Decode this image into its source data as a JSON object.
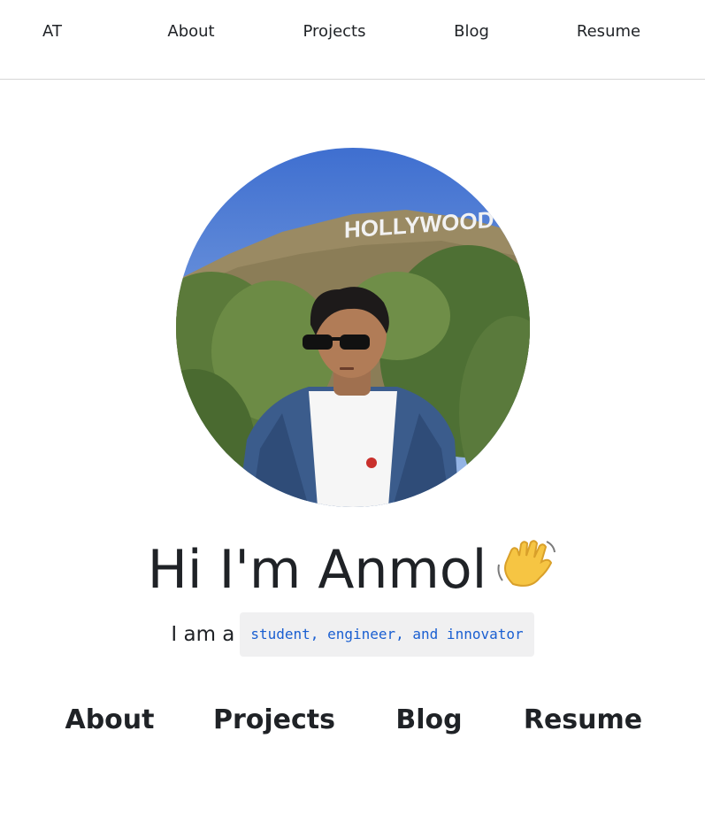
{
  "top_nav": {
    "logo": "AT",
    "items": [
      "About",
      "Projects",
      "Blog",
      "Resume"
    ]
  },
  "hero": {
    "avatar_icon": "profile-photo",
    "photo_sign_text": "HOLLYWOOD",
    "headline": "Hi I'm Anmol",
    "wave_icon": "waving-hand-icon",
    "tagline_prefix": "I am a",
    "tagline_roles": "student, engineer, and innovator"
  },
  "bottom_nav": {
    "items": [
      "About",
      "Projects",
      "Blog",
      "Resume"
    ]
  },
  "colors": {
    "text": "#1f2226",
    "code_text": "#1a5fd1",
    "code_bg": "#f0f0f1",
    "divider": "#d6d6d6"
  }
}
